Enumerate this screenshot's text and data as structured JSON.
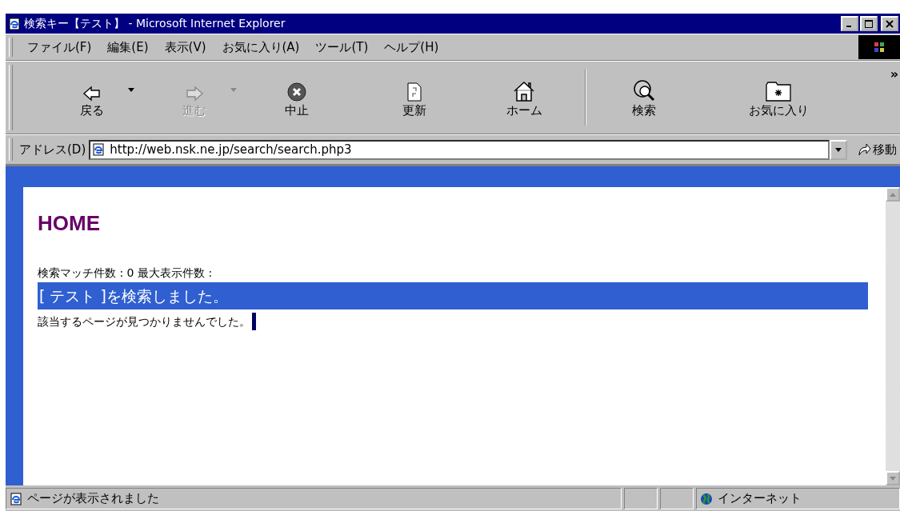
{
  "window": {
    "title": "検索キー【テスト】 - Microsoft Internet Explorer"
  },
  "menu": [
    "ファイル(F)",
    "編集(E)",
    "表示(V)",
    "お気に入り(A)",
    "ツール(T)",
    "ヘルプ(H)"
  ],
  "toolbar": [
    {
      "kind": "back",
      "label": "戻る",
      "disabled": false
    },
    {
      "kind": "dropdown",
      "disabled": false
    },
    {
      "kind": "forward",
      "label": "進む",
      "disabled": true
    },
    {
      "kind": "dropdown",
      "disabled": true
    },
    {
      "kind": "stop",
      "label": "中止",
      "disabled": false
    },
    {
      "kind": "refresh",
      "label": "更新",
      "disabled": false
    },
    {
      "kind": "home",
      "label": "ホーム",
      "disabled": false
    },
    {
      "kind": "separator"
    },
    {
      "kind": "search",
      "label": "検索",
      "disabled": false
    },
    {
      "kind": "favorites",
      "label": "お気に入り",
      "disabled": false
    }
  ],
  "toolbar_overflow": "»",
  "address": {
    "label": "アドレス(D)",
    "url": "http://web.nsk.ne.jp/search/search.php3",
    "go": "移動"
  },
  "page": {
    "heading": "HOME",
    "stats": "検索マッチ件数 : 0 最大表示件数 :",
    "banner": "[ テスト ]を検索しました。",
    "message": "該当するページが見つかりませんでした。"
  },
  "status_bar": {
    "text": "ページが表示されました",
    "zone": "インターネット"
  }
}
